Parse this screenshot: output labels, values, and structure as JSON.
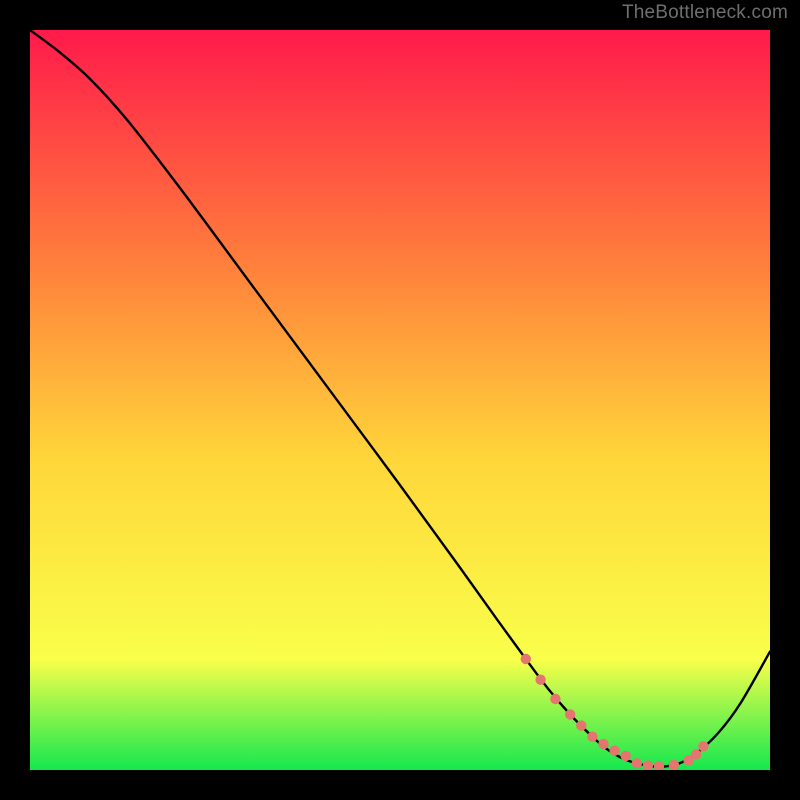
{
  "attribution": "TheBottleneck.com",
  "colors": {
    "bg_black": "#000000",
    "grad_top": "#ff1a4b",
    "grad_mid_upper": "#ff7a3c",
    "grad_mid": "#ffd63a",
    "grad_lower": "#f9ff4a",
    "grad_bottom": "#14e84e",
    "curve": "#000000",
    "marker": "#e4756f",
    "attribution_color": "#6f6f6f"
  },
  "chart_data": {
    "type": "line",
    "title": "",
    "xlabel": "",
    "ylabel": "",
    "xlim": [
      0,
      100
    ],
    "ylim": [
      0,
      100
    ],
    "series": [
      {
        "name": "bottleneck-curve",
        "x": [
          0,
          4,
          8,
          13,
          20,
          30,
          40,
          50,
          58,
          63,
          67,
          70,
          73,
          76,
          78,
          80,
          82,
          84,
          86,
          88,
          90,
          93,
          96,
          100
        ],
        "y": [
          100,
          97,
          93.5,
          88,
          79,
          65.5,
          52,
          38.5,
          27.5,
          20.5,
          15,
          11,
          7.5,
          4.5,
          2.8,
          1.6,
          0.9,
          0.5,
          0.5,
          1.0,
          2.2,
          5.0,
          9.0,
          16
        ]
      }
    ],
    "markers": {
      "name": "highlight-band",
      "x": [
        67,
        69,
        71,
        73,
        74.5,
        76,
        77.5,
        79,
        80.5,
        82,
        83.5,
        85,
        87,
        89,
        90,
        91
      ],
      "y": [
        15,
        12.2,
        9.6,
        7.5,
        6.0,
        4.5,
        3.5,
        2.6,
        1.9,
        0.9,
        0.6,
        0.5,
        0.7,
        1.3,
        2.1,
        3.2
      ]
    }
  }
}
